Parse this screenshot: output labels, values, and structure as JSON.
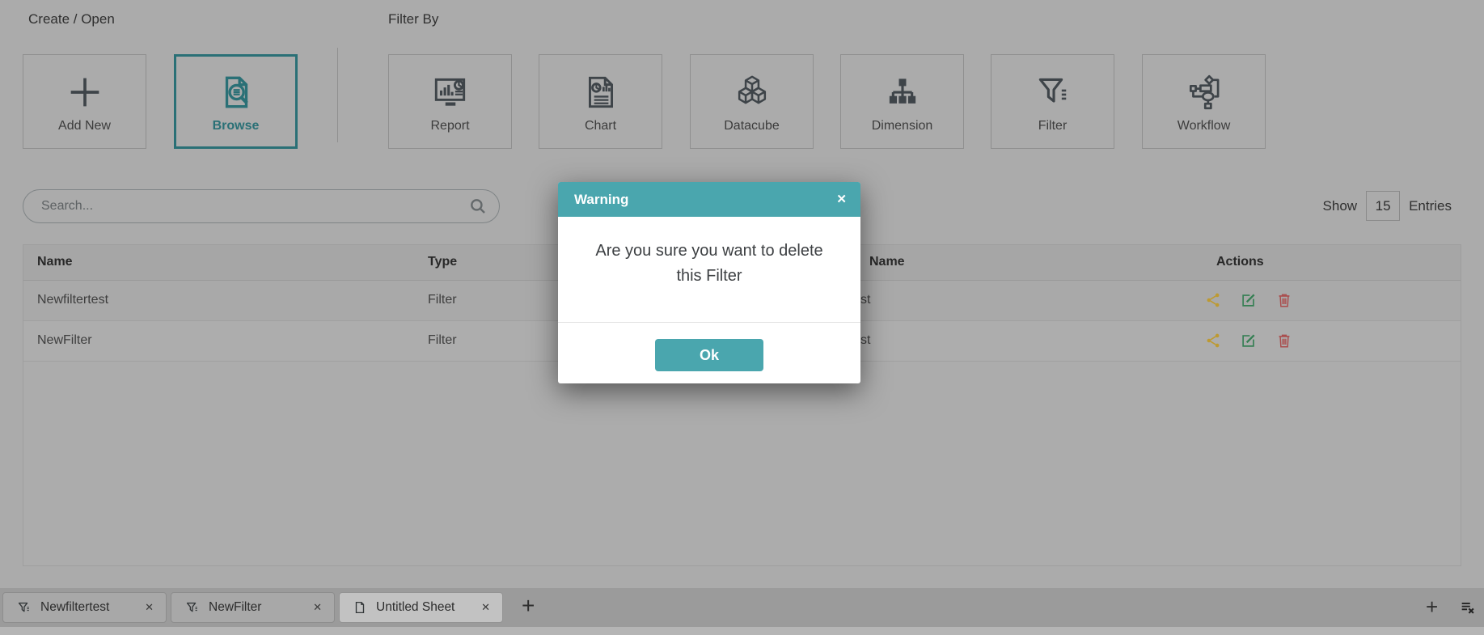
{
  "create_open": {
    "title": "Create / Open",
    "add_new_label": "Add New",
    "browse_label": "Browse"
  },
  "filter_by": {
    "title": "Filter By",
    "tiles": [
      {
        "label": "Report",
        "icon": "report-icon"
      },
      {
        "label": "Chart",
        "icon": "chart-icon"
      },
      {
        "label": "Datacube",
        "icon": "datacube-icon"
      },
      {
        "label": "Dimension",
        "icon": "dimension-icon"
      },
      {
        "label": "Filter",
        "icon": "filter-icon"
      },
      {
        "label": "Workflow",
        "icon": "workflow-icon"
      }
    ]
  },
  "search": {
    "placeholder": "Search...",
    "icon": "search-icon"
  },
  "pagination": {
    "show_label": "Show",
    "page_size": "15",
    "entries_label": "Entries"
  },
  "table": {
    "headers": {
      "name": "Name",
      "type": "Type",
      "owner_fragment": "Name",
      "actions": "Actions"
    },
    "rows": [
      {
        "name": "Newfiltertest",
        "type": "Filter",
        "owner_fragment": "st"
      },
      {
        "name": "NewFilter",
        "type": "Filter",
        "owner_fragment": "st"
      }
    ],
    "action_icons": [
      "share-icon",
      "edit-icon",
      "delete-icon"
    ]
  },
  "modal": {
    "title": "Warning",
    "close_glyph": "✕",
    "message": "Are you sure you want to delete this Filter",
    "ok_label": "Ok"
  },
  "sheet_tabs": {
    "tabs": [
      {
        "label": "Newfiltertest",
        "icon": "filter-funnel-icon",
        "active": false
      },
      {
        "label": "NewFilter",
        "icon": "filter-funnel-icon",
        "active": false
      },
      {
        "label": "Untitled Sheet",
        "icon": "sheet-document-icon",
        "active": true
      }
    ],
    "close_glyph": "✕",
    "add_glyph": "+",
    "list_icon": "sheet-list-x-icon"
  },
  "colors": {
    "accent_teal": "#4aa6ae",
    "browse_teal": "#2a7076",
    "share_gold": "#bd9a32",
    "edit_green": "#357f53",
    "delete_red": "#aa4d4d",
    "page_bg": "#ababab",
    "tabbar_bg": "#9b9b9b"
  }
}
